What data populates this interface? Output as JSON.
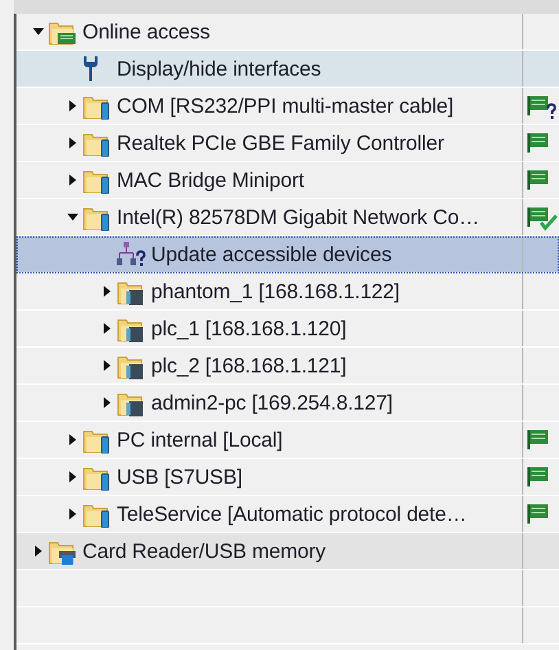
{
  "tree": [
    {
      "label": "Online access",
      "kind": "root",
      "expanded": true,
      "selected": false,
      "highlighted": false,
      "hovered": false,
      "children": [
        {
          "label": "Display/hide interfaces",
          "kind": "tool",
          "selected": false,
          "highlighted": true,
          "hovered": false
        },
        {
          "label": "COM [RS232/PPI multi-master cable]",
          "kind": "interface",
          "expanded": false,
          "selected": false,
          "highlighted": false,
          "hovered": false,
          "accessible": false,
          "connected": false
        },
        {
          "label": "Realtek PCIe GBE Family Controller",
          "kind": "interface",
          "expanded": false,
          "selected": false,
          "highlighted": false,
          "hovered": false,
          "accessible": true,
          "connected": false
        },
        {
          "label": "MAC Bridge Miniport",
          "kind": "interface",
          "expanded": false,
          "selected": false,
          "highlighted": false,
          "hovered": false,
          "accessible": true,
          "connected": false
        },
        {
          "label": "Intel(R) 82578DM Gigabit Network Co…",
          "kind": "interface",
          "expanded": true,
          "selected": false,
          "highlighted": false,
          "hovered": false,
          "accessible": true,
          "connected": true,
          "children": [
            {
              "label": "Update accessible devices",
              "kind": "update",
              "selected": true,
              "highlighted": false,
              "hovered": false
            },
            {
              "label": "phantom_1 [168.168.1.122]",
              "kind": "device",
              "expanded": false,
              "selected": false,
              "highlighted": false,
              "hovered": false
            },
            {
              "label": "plc_1 [168.168.1.120]",
              "kind": "device",
              "expanded": false,
              "selected": false,
              "highlighted": false,
              "hovered": false
            },
            {
              "label": "plc_2 [168.168.1.121]",
              "kind": "device",
              "expanded": false,
              "selected": false,
              "highlighted": false,
              "hovered": false
            },
            {
              "label": "admin2-pc [169.254.8.127]",
              "kind": "device",
              "expanded": false,
              "selected": false,
              "highlighted": false,
              "hovered": false
            }
          ]
        },
        {
          "label": "PC internal [Local]",
          "kind": "interface",
          "expanded": false,
          "selected": false,
          "highlighted": false,
          "hovered": false,
          "accessible": true,
          "connected": false
        },
        {
          "label": "USB [S7USB]",
          "kind": "interface",
          "expanded": false,
          "selected": false,
          "highlighted": false,
          "hovered": false,
          "accessible": true,
          "connected": false
        },
        {
          "label": "TeleService [Automatic protocol dete…",
          "kind": "interface",
          "expanded": false,
          "selected": false,
          "highlighted": false,
          "hovered": false,
          "accessible": true,
          "connected": false
        }
      ]
    },
    {
      "label": "Card Reader/USB memory",
      "kind": "reader",
      "expanded": false,
      "selected": false,
      "highlighted": false,
      "hovered": true
    }
  ]
}
